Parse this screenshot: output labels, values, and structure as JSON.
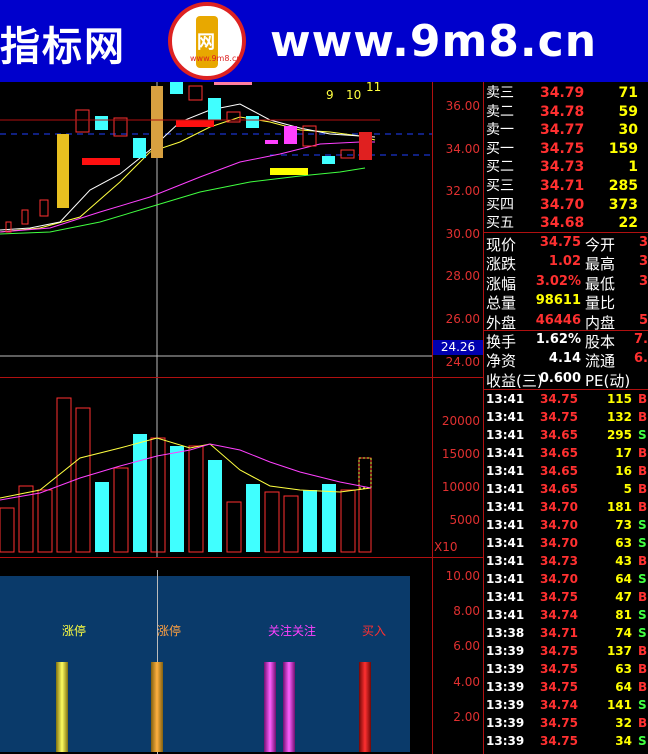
{
  "header": {
    "site_name": "指标网",
    "site_url": "www.9m8.cn",
    "logo_char": "网",
    "logo_sub": "www.9m8.cn"
  },
  "price_axis": [
    "36.00",
    "34.00",
    "32.00",
    "30.00",
    "28.00",
    "26.00",
    "24.00"
  ],
  "crosshair_price": "24.26",
  "top_labels": [
    "9",
    "10",
    "11"
  ],
  "volume_axis": [
    "20000",
    "15000",
    "10000",
    "5000"
  ],
  "volume_unit": "X10",
  "indicator_axis": [
    "10.00",
    "8.00",
    "6.00",
    "4.00",
    "2.00"
  ],
  "signals": [
    {
      "label": "涨停",
      "color": "#ffff40"
    },
    {
      "label": "涨停",
      "color": "#ffa040"
    },
    {
      "label": "关注关注",
      "color": "#ff40ff"
    },
    {
      "label": "买入",
      "color": "#ff3030"
    }
  ],
  "quotes": [
    {
      "name": "卖三",
      "price": "34.79",
      "vol": "71"
    },
    {
      "name": "卖二",
      "price": "34.78",
      "vol": "59"
    },
    {
      "name": "卖一",
      "price": "34.77",
      "vol": "30"
    },
    {
      "name": "买一",
      "price": "34.75",
      "vol": "159"
    },
    {
      "name": "买二",
      "price": "34.73",
      "vol": "1"
    },
    {
      "name": "买三",
      "price": "34.71",
      "vol": "285"
    },
    {
      "name": "买四",
      "price": "34.70",
      "vol": "373"
    },
    {
      "name": "买五",
      "price": "34.68",
      "vol": "22"
    }
  ],
  "info": [
    {
      "label": "现价",
      "value": "34.75",
      "color": "#ff3030",
      "label2": "今开",
      "value2": "3"
    },
    {
      "label": "涨跌",
      "value": "1.02",
      "color": "#ff3030",
      "label2": "最高",
      "value2": "3"
    },
    {
      "label": "涨幅",
      "value": "3.02%",
      "color": "#ff3030",
      "label2": "最低",
      "value2": "3"
    },
    {
      "label": "总量",
      "value": "98611",
      "color": "#ffff00",
      "label2": "量比",
      "value2": ""
    },
    {
      "label": "外盘",
      "value": "46446",
      "color": "#ff3030",
      "label2": "内盘",
      "value2": "5"
    },
    {
      "label": "换手",
      "value": "1.62%",
      "color": "#ffffff",
      "label2": "股本",
      "value2": "7."
    },
    {
      "label": "净资",
      "value": "4.14",
      "color": "#ffffff",
      "label2": "流通",
      "value2": "6."
    },
    {
      "label": "收益(三)",
      "value": "0.600",
      "color": "#ffffff",
      "label2": "PE(动)",
      "value2": ""
    }
  ],
  "ticks": [
    {
      "time": "13:41",
      "price": "34.75",
      "vol": "115",
      "side": "B"
    },
    {
      "time": "13:41",
      "price": "34.75",
      "vol": "132",
      "side": "B"
    },
    {
      "time": "13:41",
      "price": "34.65",
      "vol": "295",
      "side": "S"
    },
    {
      "time": "13:41",
      "price": "34.65",
      "vol": "17",
      "side": "B"
    },
    {
      "time": "13:41",
      "price": "34.65",
      "vol": "16",
      "side": "B"
    },
    {
      "time": "13:41",
      "price": "34.65",
      "vol": "5",
      "side": "B"
    },
    {
      "time": "13:41",
      "price": "34.70",
      "vol": "181",
      "side": "B"
    },
    {
      "time": "13:41",
      "price": "34.70",
      "vol": "73",
      "side": "S"
    },
    {
      "time": "13:41",
      "price": "34.70",
      "vol": "63",
      "side": "S"
    },
    {
      "time": "13:41",
      "price": "34.73",
      "vol": "43",
      "side": "B"
    },
    {
      "time": "13:41",
      "price": "34.70",
      "vol": "64",
      "side": "S"
    },
    {
      "time": "13:41",
      "price": "34.75",
      "vol": "47",
      "side": "B"
    },
    {
      "time": "13:41",
      "price": "34.74",
      "vol": "81",
      "side": "S"
    },
    {
      "time": "13:38",
      "price": "34.71",
      "vol": "74",
      "side": "S"
    },
    {
      "time": "13:39",
      "price": "34.75",
      "vol": "137",
      "side": "B"
    },
    {
      "time": "13:39",
      "price": "34.75",
      "vol": "63",
      "side": "B"
    },
    {
      "time": "13:39",
      "price": "34.75",
      "vol": "64",
      "side": "B"
    },
    {
      "time": "13:39",
      "price": "34.74",
      "vol": "141",
      "side": "S"
    },
    {
      "time": "13:39",
      "price": "34.75",
      "vol": "32",
      "side": "B"
    },
    {
      "time": "13:39",
      "price": "34.75",
      "vol": "34",
      "side": "S"
    }
  ],
  "colors": {
    "up": "#ff3030",
    "down": "#40ffff",
    "grid": "#b01010",
    "ma5": "#ffffff",
    "ma10": "#ffff40",
    "ma20": "#ff40ff",
    "ma60": "#40ff40"
  }
}
